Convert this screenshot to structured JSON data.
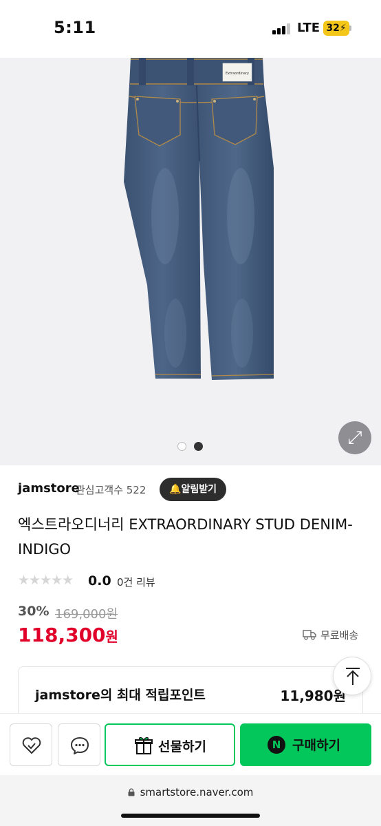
{
  "status_bar": {
    "time": "5:11",
    "network": "LTE",
    "battery": "32"
  },
  "gallery": {
    "image_alt": "denim jeans back view",
    "total_images": 2,
    "current_image": 2,
    "label_tag": "Extraordinary"
  },
  "store": {
    "name": "jamstore",
    "followers": "관심고객수 522",
    "alarm_button": "알림받기"
  },
  "product": {
    "title": "엑스트라오디너리 EXTRAORDINARY STUD DENIM-INDIGO",
    "rating": "0.0",
    "reviews": "0건 리뷰",
    "discount": "30%",
    "original_price": "169,000원",
    "price": "118,300",
    "price_unit": "원",
    "shipping": "무료배송"
  },
  "points": {
    "label": "jamstore의 최대 적립포인트",
    "value": "11,980원"
  },
  "actions": {
    "gift_label": "선물하기",
    "buy_label": "구매하기",
    "naver_logo": "N"
  },
  "browser": {
    "url": "smartstore.naver.com"
  },
  "colors": {
    "accent_green": "#03c75a",
    "price_red": "#e0002a"
  }
}
